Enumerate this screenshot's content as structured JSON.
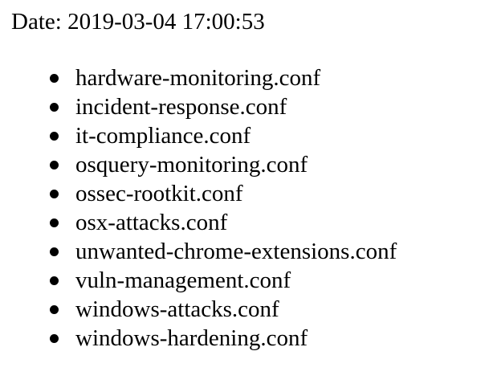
{
  "header": {
    "date_label": "Date:",
    "date_value": "2019-03-04 17:00:53"
  },
  "files": [
    "hardware-monitoring.conf",
    "incident-response.conf",
    "it-compliance.conf",
    "osquery-monitoring.conf",
    "ossec-rootkit.conf",
    "osx-attacks.conf",
    "unwanted-chrome-extensions.conf",
    "vuln-management.conf",
    "windows-attacks.conf",
    "windows-hardening.conf"
  ]
}
